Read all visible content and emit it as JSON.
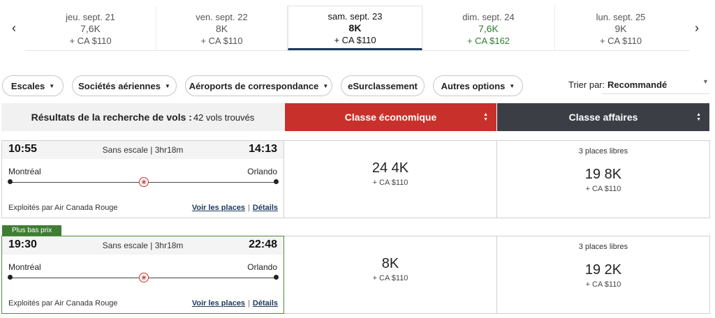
{
  "date_strip": {
    "days": [
      {
        "label": "jeu. sept. 21",
        "points": "7,6K",
        "cash": "+ CA $110"
      },
      {
        "label": "ven. sept. 22",
        "points": "8K",
        "cash": "+ CA $110"
      },
      {
        "label": "sam. sept. 23",
        "points": "8K",
        "cash": "+ CA $110"
      },
      {
        "label": "dim. sept. 24",
        "points": "7,6K",
        "cash": "+ CA $162"
      },
      {
        "label": "lun. sept. 25",
        "points": "9K",
        "cash": "+ CA $110"
      }
    ],
    "prev_icon": "chevron-left-icon",
    "next_icon": "chevron-right-icon"
  },
  "filters": {
    "stops": "Escales",
    "airlines": "Sociétés aériennes",
    "connecting_airports": "Aéroports de correspondance",
    "upgrade": "eSurclassement",
    "more_options": "Autres options",
    "sort_label": "Trier par:",
    "sort_value": "Recommandé"
  },
  "results_header": {
    "title": "Résultats de la recherche de vols :",
    "count": "42 vols trouvés",
    "economy": "Classe économique",
    "business": "Classe affaires"
  },
  "flights": [
    {
      "departure": "10:55",
      "arrival": "14:13",
      "stops_duration": "Sans escale | 3hr18m",
      "origin": "Montréal",
      "destination": "Orlando",
      "operator": "Exploités par Air Canada Rouge",
      "seats_link": "Voir les places",
      "details_link": "Détails",
      "economy": {
        "points": "24 4K",
        "cash": "+ CA $110"
      },
      "business": {
        "seats": "3 places libres",
        "points": "19 8K",
        "cash": "+ CA $110"
      }
    },
    {
      "badge": "Plus bas prix",
      "departure": "19:30",
      "arrival": "22:48",
      "stops_duration": "Sans escale | 3hr18m",
      "origin": "Montréal",
      "destination": "Orlando",
      "operator": "Exploités par Air Canada Rouge",
      "seats_link": "Voir les places",
      "details_link": "Détails",
      "economy": {
        "points": "8K",
        "cash": "+ CA $110"
      },
      "business": {
        "seats": "3 places libres",
        "points": "19 2K",
        "cash": "+ CA $110"
      }
    }
  ],
  "colors": {
    "economy_header": "#c8312b",
    "business_header": "#3b3f45",
    "lowest_price_badge": "#3f7d33",
    "cheaper_day_text": "#2e7d32",
    "selected_day_underline": "#1d3a5c"
  },
  "icons": {
    "airline_logo": "maple-leaf-icon",
    "dropdown": "caret-down-icon",
    "sort_toggle": "sort-arrows-icon"
  }
}
